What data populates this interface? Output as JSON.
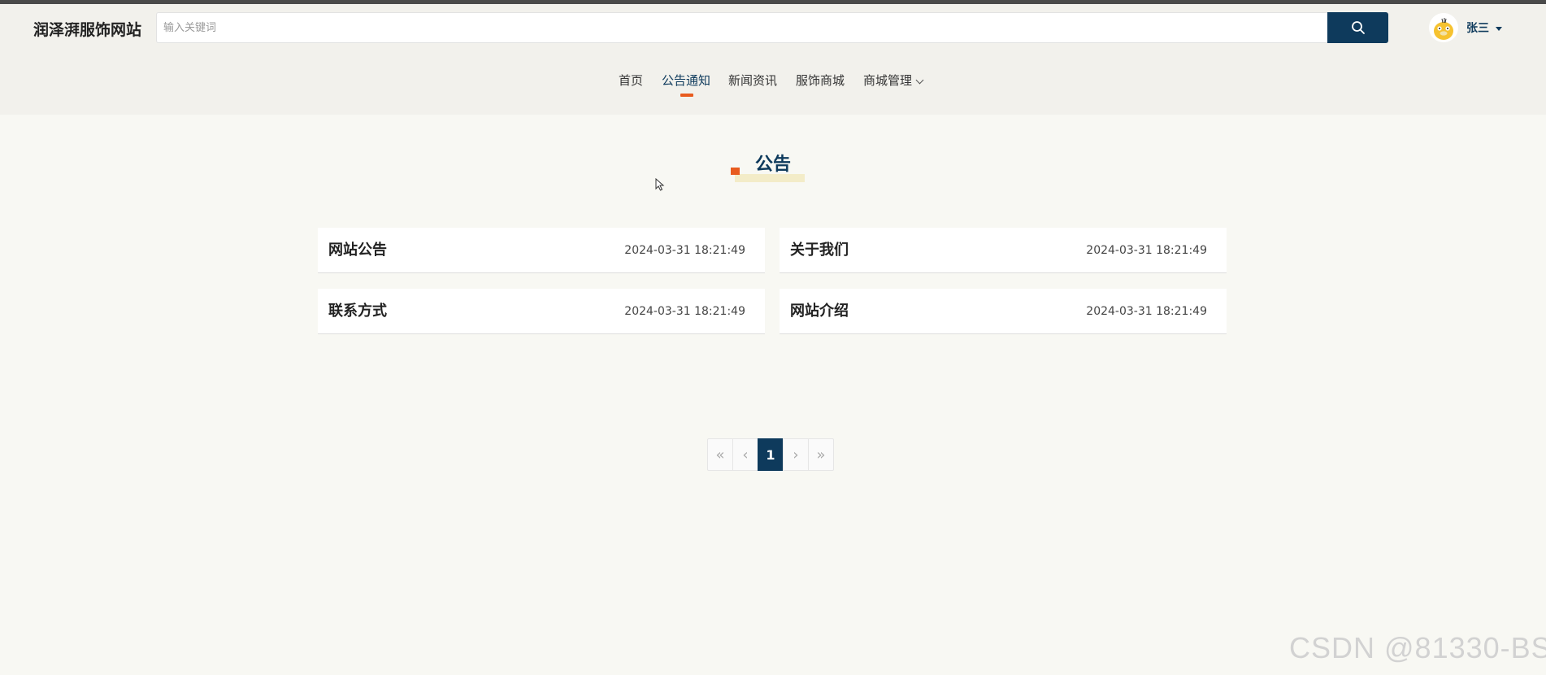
{
  "header": {
    "logo_text": "润泽湃服饰网站",
    "search": {
      "placeholder": "输入关键词",
      "value": ""
    },
    "user": {
      "name": "张三",
      "avatar": "duck-avatar"
    },
    "accent_color": "#0e3a5c"
  },
  "nav": {
    "items": [
      {
        "label": "首页"
      },
      {
        "label": "公告通知",
        "active": true
      },
      {
        "label": "新闻资讯"
      },
      {
        "label": "服饰商城"
      },
      {
        "label": "商城管理",
        "has_dropdown": true
      }
    ]
  },
  "section": {
    "title": "公告"
  },
  "notices": [
    {
      "title": "网站公告",
      "date": "2024-03-31 18:21:49"
    },
    {
      "title": "关于我们",
      "date": "2024-03-31 18:21:49"
    },
    {
      "title": "联系方式",
      "date": "2024-03-31 18:21:49"
    },
    {
      "title": "网站介绍",
      "date": "2024-03-31 18:21:49"
    }
  ],
  "pagination": {
    "first": "«",
    "prev": "‹",
    "current": "1",
    "next": "›",
    "last": "»"
  },
  "watermark": "CSDN @81330-BS"
}
